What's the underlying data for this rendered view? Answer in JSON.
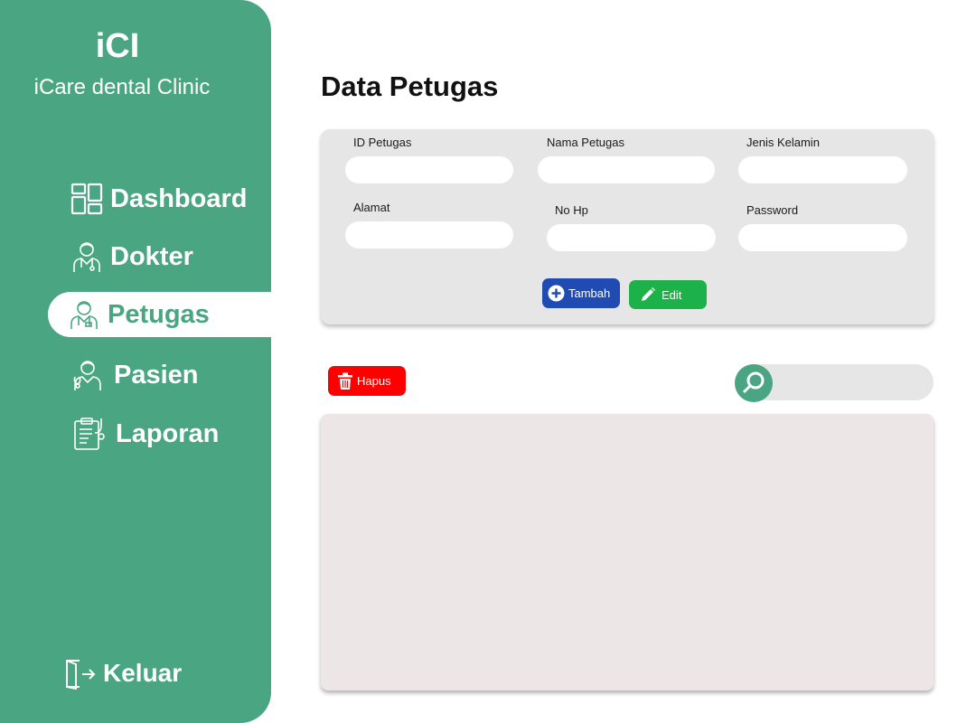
{
  "sidebar": {
    "logo": "iCI",
    "brand_name": "iCare dental Clinic",
    "items": [
      {
        "label": "Dashboard",
        "icon": "dashboard-grid-icon"
      },
      {
        "label": "Dokter",
        "icon": "doctor-icon"
      },
      {
        "label": "Petugas",
        "icon": "staff-icon",
        "active": true
      },
      {
        "label": "Pasien",
        "icon": "patient-icon"
      },
      {
        "label": "Laporan",
        "icon": "report-clipboard-icon"
      }
    ],
    "logout_label": "Keluar"
  },
  "main": {
    "title": "Data Petugas",
    "form": {
      "id_label": "ID Petugas",
      "nama_label": "Nama Petugas",
      "jk_label": "Jenis Kelamin",
      "alamat_label": "Alamat",
      "hp_label": "No Hp",
      "password_label": "Password"
    },
    "buttons": {
      "tambah": "Tambah",
      "edit": "Edit",
      "hapus": "Hapus"
    }
  },
  "colors": {
    "sidebar": "#4aa583",
    "tambah": "#1f4bb3",
    "edit": "#1db14a",
    "hapus": "#ff0000"
  }
}
